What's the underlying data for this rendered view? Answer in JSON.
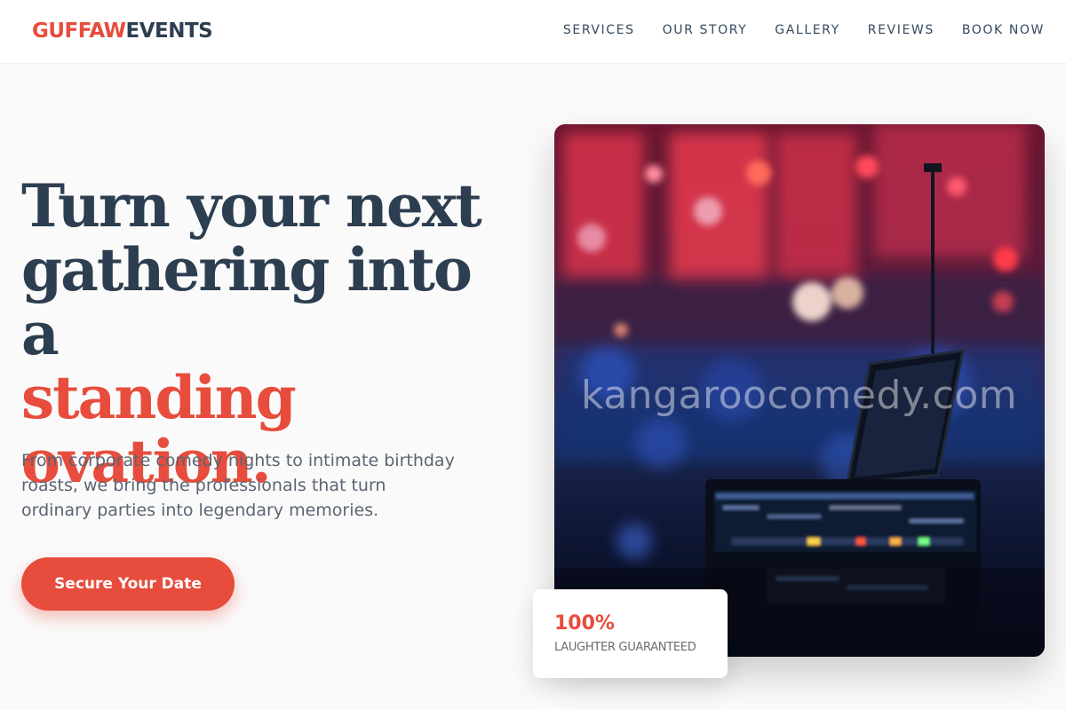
{
  "header": {
    "logo_part1": "GUFFAW",
    "logo_part2": "EVENTS",
    "nav": [
      {
        "label": "SERVICES"
      },
      {
        "label": "OUR STORY"
      },
      {
        "label": "GALLERY"
      },
      {
        "label": "REVIEWS"
      },
      {
        "label": "BOOK NOW"
      }
    ]
  },
  "hero": {
    "headline_line1": "Turn your next",
    "headline_line2": "gathering into a",
    "headline_accent1": "standing",
    "headline_accent2": "ovation.",
    "subtext": "From corporate comedy nights to intimate birthday roasts, we bring the professionals that turn ordinary parties into legendary memories.",
    "cta_label": "Secure Your Date"
  },
  "image": {
    "watermark": "kangaroocomedy.com"
  },
  "badge": {
    "value": "100%",
    "label": "LAUGHTER GUARANTEED"
  },
  "colors": {
    "accent": "#e74c3c",
    "primary": "#2c3e50",
    "background": "#fafafa"
  }
}
